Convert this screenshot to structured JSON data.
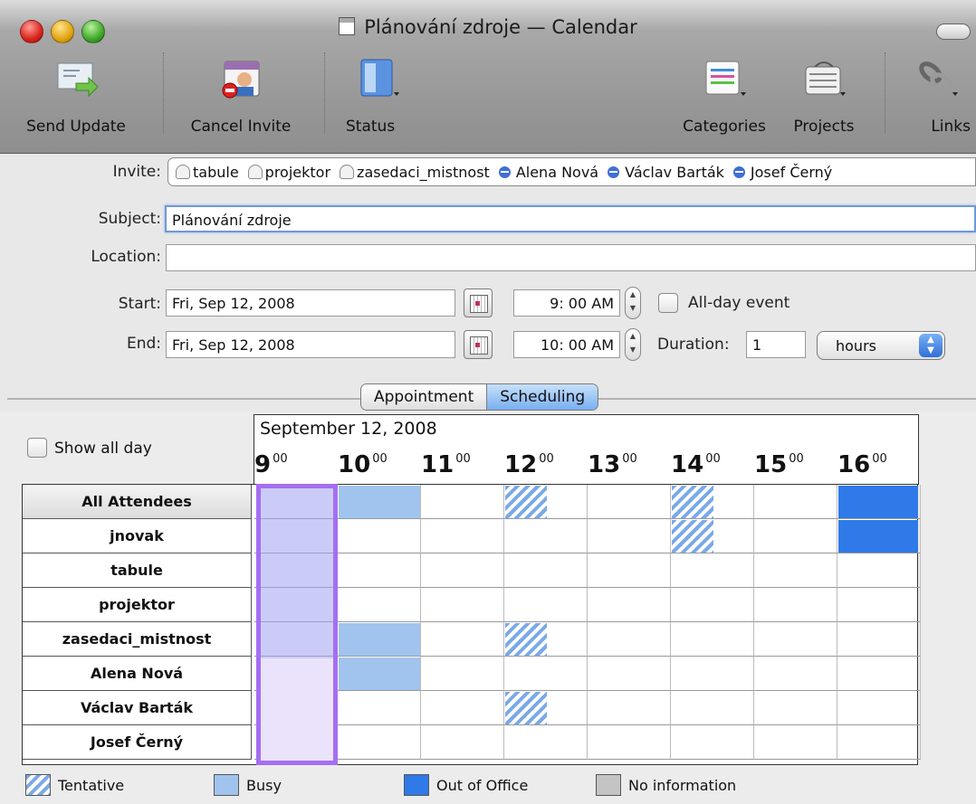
{
  "window": {
    "title": "Plánování zdroje — Calendar"
  },
  "toolbar": {
    "send_update": "Send Update",
    "cancel_invite": "Cancel Invite",
    "status": "Status",
    "categories": "Categories",
    "projects": "Projects",
    "links": "Links"
  },
  "form": {
    "invite_label": "Invite:",
    "invitees": [
      {
        "name": "tabule",
        "kind": "resource"
      },
      {
        "name": "projektor",
        "kind": "resource"
      },
      {
        "name": "zasedaci_mistnost",
        "kind": "resource"
      },
      {
        "name": "Alena Nová",
        "kind": "person"
      },
      {
        "name": "Václav Barták",
        "kind": "person"
      },
      {
        "name": "Josef Černý",
        "kind": "person"
      }
    ],
    "subject_label": "Subject:",
    "subject_value": "Plánování zdroje",
    "location_label": "Location:",
    "location_value": "",
    "start_label": "Start:",
    "start_date": "Fri, Sep 12, 2008",
    "start_time": "9: 00 AM",
    "end_label": "End:",
    "end_date": "Fri, Sep 12, 2008",
    "end_time": "10: 00 AM",
    "allday_label": "All-day event",
    "duration_label": "Duration:",
    "duration_value": "1",
    "duration_unit": "hours"
  },
  "tabs": {
    "appointment": "Appointment",
    "scheduling": "Scheduling",
    "active": "Scheduling"
  },
  "schedule": {
    "show_all_day": "Show all day",
    "date": "September 12, 2008",
    "hours": [
      "9",
      "10",
      "11",
      "12",
      "13",
      "14",
      "15",
      "16"
    ],
    "minutes": "00",
    "rows": [
      {
        "name": "All Attendees",
        "busy": [
          10
        ],
        "tentative": [
          12,
          14
        ],
        "out_of_office": [
          16
        ]
      },
      {
        "name": "jnovak",
        "busy": [],
        "tentative": [
          14
        ],
        "out_of_office": [
          16
        ]
      },
      {
        "name": "tabule",
        "busy": [],
        "tentative": [],
        "out_of_office": []
      },
      {
        "name": "projektor",
        "busy": [],
        "tentative": [],
        "out_of_office": []
      },
      {
        "name": "zasedaci_mistnost",
        "busy": [
          10
        ],
        "tentative": [
          12
        ],
        "out_of_office": []
      },
      {
        "name": "Alena Nová",
        "busy": [
          10
        ],
        "tentative": [],
        "out_of_office": []
      },
      {
        "name": "Václav Barták",
        "busy": [],
        "tentative": [
          12
        ],
        "out_of_office": []
      },
      {
        "name": "Josef Černý",
        "busy": [],
        "tentative": [],
        "out_of_office": []
      }
    ]
  },
  "legend": {
    "tentative": "Tentative",
    "busy": "Busy",
    "out_of_office": "Out of Office",
    "no_information": "No information"
  },
  "colors": {
    "busy": "#a1c4ef",
    "out_of_office": "#2f7ae8",
    "selection": "#a56ef2",
    "no_information": "#c4c4c4"
  }
}
